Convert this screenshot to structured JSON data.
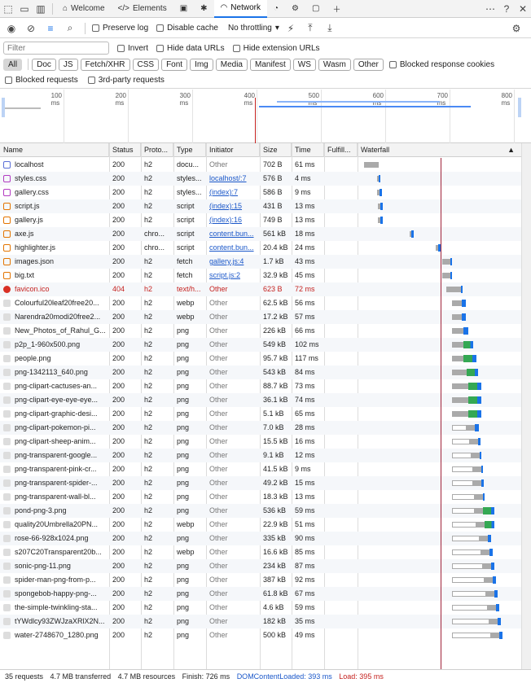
{
  "tabs": [
    {
      "label": "Welcome",
      "icon": "home-icon"
    },
    {
      "label": "Elements",
      "icon": "code-icon"
    },
    {
      "label": "",
      "icon": "console-icon"
    },
    {
      "label": "",
      "icon": "bug-icon"
    },
    {
      "label": "Network",
      "icon": "wifi-icon"
    },
    {
      "label": "",
      "icon": "performance-icon"
    },
    {
      "label": "",
      "icon": "gear-icon"
    },
    {
      "label": "",
      "icon": "window-icon"
    }
  ],
  "toolbar": {
    "preserve_log": "Preserve log",
    "disable_cache": "Disable cache",
    "throttling": "No throttling"
  },
  "filter": {
    "placeholder": "Filter",
    "invert": "Invert",
    "hide_data_urls": "Hide data URLs",
    "hide_ext_urls": "Hide extension URLs"
  },
  "types": [
    "All",
    "Doc",
    "JS",
    "Fetch/XHR",
    "CSS",
    "Font",
    "Img",
    "Media",
    "Manifest",
    "WS",
    "Wasm",
    "Other"
  ],
  "blocked_cookies": "Blocked response cookies",
  "blocked_requests": "Blocked requests",
  "third_party": "3rd-party requests",
  "overview_ticks": [
    "100 ms",
    "200 ms",
    "300 ms",
    "400 ms",
    "500 ms",
    "600 ms",
    "700 ms",
    "800 ms"
  ],
  "columns": [
    "Name",
    "Status",
    "Proto...",
    "Type",
    "Initiator",
    "Size",
    "Time",
    "Fulfill...",
    "Waterfall"
  ],
  "accent": "#1a73e8",
  "rows": [
    {
      "name": "localhost",
      "status": "200",
      "proto": "h2",
      "type": "docu...",
      "init": "Other",
      "size": "702 B",
      "time": "61 ms",
      "icon": "doc",
      "w": [
        4,
        18,
        0
      ]
    },
    {
      "name": "styles.css",
      "status": "200",
      "proto": "h2",
      "type": "styles...",
      "init": "localhost/:7",
      "size": "576 B",
      "time": "4 ms",
      "icon": "css",
      "w": [
        20,
        2,
        2
      ]
    },
    {
      "name": "gallery.css",
      "status": "200",
      "proto": "h2",
      "type": "styles...",
      "init": "(index):7",
      "size": "586 B",
      "time": "9 ms",
      "icon": "css",
      "w": [
        20,
        3,
        3
      ]
    },
    {
      "name": "script.js",
      "status": "200",
      "proto": "h2",
      "type": "script",
      "init": "(index):15",
      "size": "431 B",
      "time": "13 ms",
      "icon": "js",
      "w": [
        21,
        3,
        3
      ]
    },
    {
      "name": "gallery.js",
      "status": "200",
      "proto": "h2",
      "type": "script",
      "init": "(index):16",
      "size": "749 B",
      "time": "13 ms",
      "icon": "js",
      "w": [
        21,
        3,
        3
      ]
    },
    {
      "name": "axe.js",
      "status": "200",
      "proto": "chro...",
      "type": "script",
      "init": "content.bun...",
      "size": "561 kB",
      "time": "18 ms",
      "icon": "js",
      "w": [
        60,
        2,
        3
      ]
    },
    {
      "name": "highlighter.js",
      "status": "200",
      "proto": "chro...",
      "type": "script",
      "init": "content.bun...",
      "size": "20.4 kB",
      "time": "24 ms",
      "icon": "js",
      "w": [
        92,
        3,
        3
      ]
    },
    {
      "name": "images.json",
      "status": "200",
      "proto": "h2",
      "type": "fetch",
      "init": "gallery.js:4",
      "size": "1.7 kB",
      "time": "43 ms",
      "icon": "json",
      "w": [
        100,
        10,
        2
      ]
    },
    {
      "name": "big.txt",
      "status": "200",
      "proto": "h2",
      "type": "fetch",
      "init": "script.js:2",
      "size": "32.9 kB",
      "time": "45 ms",
      "icon": "json",
      "w": [
        100,
        10,
        2
      ]
    },
    {
      "name": "favicon.ico",
      "status": "404",
      "proto": "h2",
      "type": "text/h...",
      "init": "Other",
      "size": "623 B",
      "time": "72 ms",
      "icon": "error",
      "w": [
        105,
        18,
        2
      ]
    },
    {
      "name": "Colourful20leaf20free20...",
      "status": "200",
      "proto": "h2",
      "type": "webp",
      "init": "Other",
      "size": "62.5 kB",
      "time": "56 ms",
      "icon": "img",
      "w": [
        112,
        12,
        5
      ]
    },
    {
      "name": "Narendra20modi20free2...",
      "status": "200",
      "proto": "h2",
      "type": "webp",
      "init": "Other",
      "size": "17.2 kB",
      "time": "57 ms",
      "icon": "img",
      "w": [
        112,
        12,
        5
      ]
    },
    {
      "name": "New_Photos_of_Rahul_G...",
      "status": "200",
      "proto": "h2",
      "type": "png",
      "init": "Other",
      "size": "226 kB",
      "time": "66 ms",
      "icon": "img",
      "w": [
        112,
        14,
        6
      ]
    },
    {
      "name": "p2p_1-960x500.png",
      "status": "200",
      "proto": "h2",
      "type": "png",
      "init": "Other",
      "size": "549 kB",
      "time": "102 ms",
      "icon": "img",
      "w": [
        112,
        14,
        12
      ]
    },
    {
      "name": "people.png",
      "status": "200",
      "proto": "h2",
      "type": "png",
      "init": "Other",
      "size": "95.7 kB",
      "time": "117 ms",
      "icon": "img",
      "w": [
        112,
        14,
        16
      ]
    },
    {
      "name": "png-1342113_640.png",
      "status": "200",
      "proto": "h2",
      "type": "png",
      "init": "Other",
      "size": "543 kB",
      "time": "84 ms",
      "icon": "img",
      "w": [
        112,
        18,
        14
      ]
    },
    {
      "name": "png-clipart-cactuses-an...",
      "status": "200",
      "proto": "h2",
      "type": "png",
      "init": "Other",
      "size": "88.7 kB",
      "time": "73 ms",
      "icon": "img",
      "w": [
        112,
        20,
        16
      ]
    },
    {
      "name": "png-clipart-eye-eye-eye...",
      "status": "200",
      "proto": "h2",
      "type": "png",
      "init": "Other",
      "size": "36.1 kB",
      "time": "74 ms",
      "icon": "img",
      "w": [
        112,
        20,
        16
      ]
    },
    {
      "name": "png-clipart-graphic-desi...",
      "status": "200",
      "proto": "h2",
      "type": "png",
      "init": "Other",
      "size": "5.1 kB",
      "time": "65 ms",
      "icon": "img",
      "w": [
        112,
        20,
        16
      ]
    },
    {
      "name": "png-clipart-pokemon-pi...",
      "status": "200",
      "proto": "h2",
      "type": "png",
      "init": "Other",
      "size": "7.0 kB",
      "time": "28 ms",
      "icon": "img",
      "w": [
        112,
        28,
        5
      ]
    },
    {
      "name": "png-clipart-sheep-anim...",
      "status": "200",
      "proto": "h2",
      "type": "png",
      "init": "Other",
      "size": "15.5 kB",
      "time": "16 ms",
      "icon": "img",
      "w": [
        112,
        32,
        3
      ]
    },
    {
      "name": "png-transparent-google...",
      "status": "200",
      "proto": "h2",
      "type": "png",
      "init": "Other",
      "size": "9.1 kB",
      "time": "12 ms",
      "icon": "img",
      "w": [
        112,
        34,
        2
      ]
    },
    {
      "name": "png-transparent-pink-cr...",
      "status": "200",
      "proto": "h2",
      "type": "png",
      "init": "Other",
      "size": "41.5 kB",
      "time": "9 ms",
      "icon": "img",
      "w": [
        112,
        36,
        2
      ]
    },
    {
      "name": "png-transparent-spider-...",
      "status": "200",
      "proto": "h2",
      "type": "png",
      "init": "Other",
      "size": "49.2 kB",
      "time": "15 ms",
      "icon": "img",
      "w": [
        112,
        36,
        3
      ]
    },
    {
      "name": "png-transparent-wall-bl...",
      "status": "200",
      "proto": "h2",
      "type": "png",
      "init": "Other",
      "size": "18.3 kB",
      "time": "13 ms",
      "icon": "img",
      "w": [
        112,
        38,
        2
      ]
    },
    {
      "name": "pond-png-3.png",
      "status": "200",
      "proto": "h2",
      "type": "png",
      "init": "Other",
      "size": "536 kB",
      "time": "59 ms",
      "icon": "img",
      "w": [
        112,
        38,
        14
      ]
    },
    {
      "name": "quality20Umbrella20PN...",
      "status": "200",
      "proto": "h2",
      "type": "webp",
      "init": "Other",
      "size": "22.9 kB",
      "time": "51 ms",
      "icon": "img",
      "w": [
        112,
        40,
        12
      ]
    },
    {
      "name": "rose-66-928x1024.png",
      "status": "200",
      "proto": "h2",
      "type": "png",
      "init": "Other",
      "size": "335 kB",
      "time": "90 ms",
      "icon": "img",
      "w": [
        112,
        44,
        4
      ]
    },
    {
      "name": "s207C20Transparent20b...",
      "status": "200",
      "proto": "h2",
      "type": "webp",
      "init": "Other",
      "size": "16.6 kB",
      "time": "85 ms",
      "icon": "img",
      "w": [
        112,
        46,
        4
      ]
    },
    {
      "name": "sonic-png-11.png",
      "status": "200",
      "proto": "h2",
      "type": "png",
      "init": "Other",
      "size": "234 kB",
      "time": "87 ms",
      "icon": "img",
      "w": [
        112,
        48,
        4
      ]
    },
    {
      "name": "spider-man-png-from-p...",
      "status": "200",
      "proto": "h2",
      "type": "png",
      "init": "Other",
      "size": "387 kB",
      "time": "92 ms",
      "icon": "img",
      "w": [
        112,
        50,
        4
      ]
    },
    {
      "name": "spongebob-happy-png-...",
      "status": "200",
      "proto": "h2",
      "type": "png",
      "init": "Other",
      "size": "61.8 kB",
      "time": "67 ms",
      "icon": "img",
      "w": [
        112,
        52,
        4
      ]
    },
    {
      "name": "the-simple-twinkling-sta...",
      "status": "200",
      "proto": "h2",
      "type": "png",
      "init": "Other",
      "size": "4.6 kB",
      "time": "59 ms",
      "icon": "img",
      "w": [
        112,
        54,
        4
      ]
    },
    {
      "name": "tYWdlcy93ZWJzaXRlX2N...",
      "status": "200",
      "proto": "h2",
      "type": "png",
      "init": "Other",
      "size": "182 kB",
      "time": "35 ms",
      "icon": "img",
      "w": [
        112,
        56,
        4
      ]
    },
    {
      "name": "water-2748670_1280.png",
      "status": "200",
      "proto": "h2",
      "type": "png",
      "init": "Other",
      "size": "500 kB",
      "time": "49 ms",
      "icon": "img",
      "w": [
        112,
        58,
        4
      ]
    }
  ],
  "status": {
    "requests": "35 requests",
    "transferred": "4.7 MB transferred",
    "resources": "4.7 MB resources",
    "finish": "Finish: 726 ms",
    "dcl": "DOMContentLoaded: 393 ms",
    "load": "Load: 395 ms"
  }
}
